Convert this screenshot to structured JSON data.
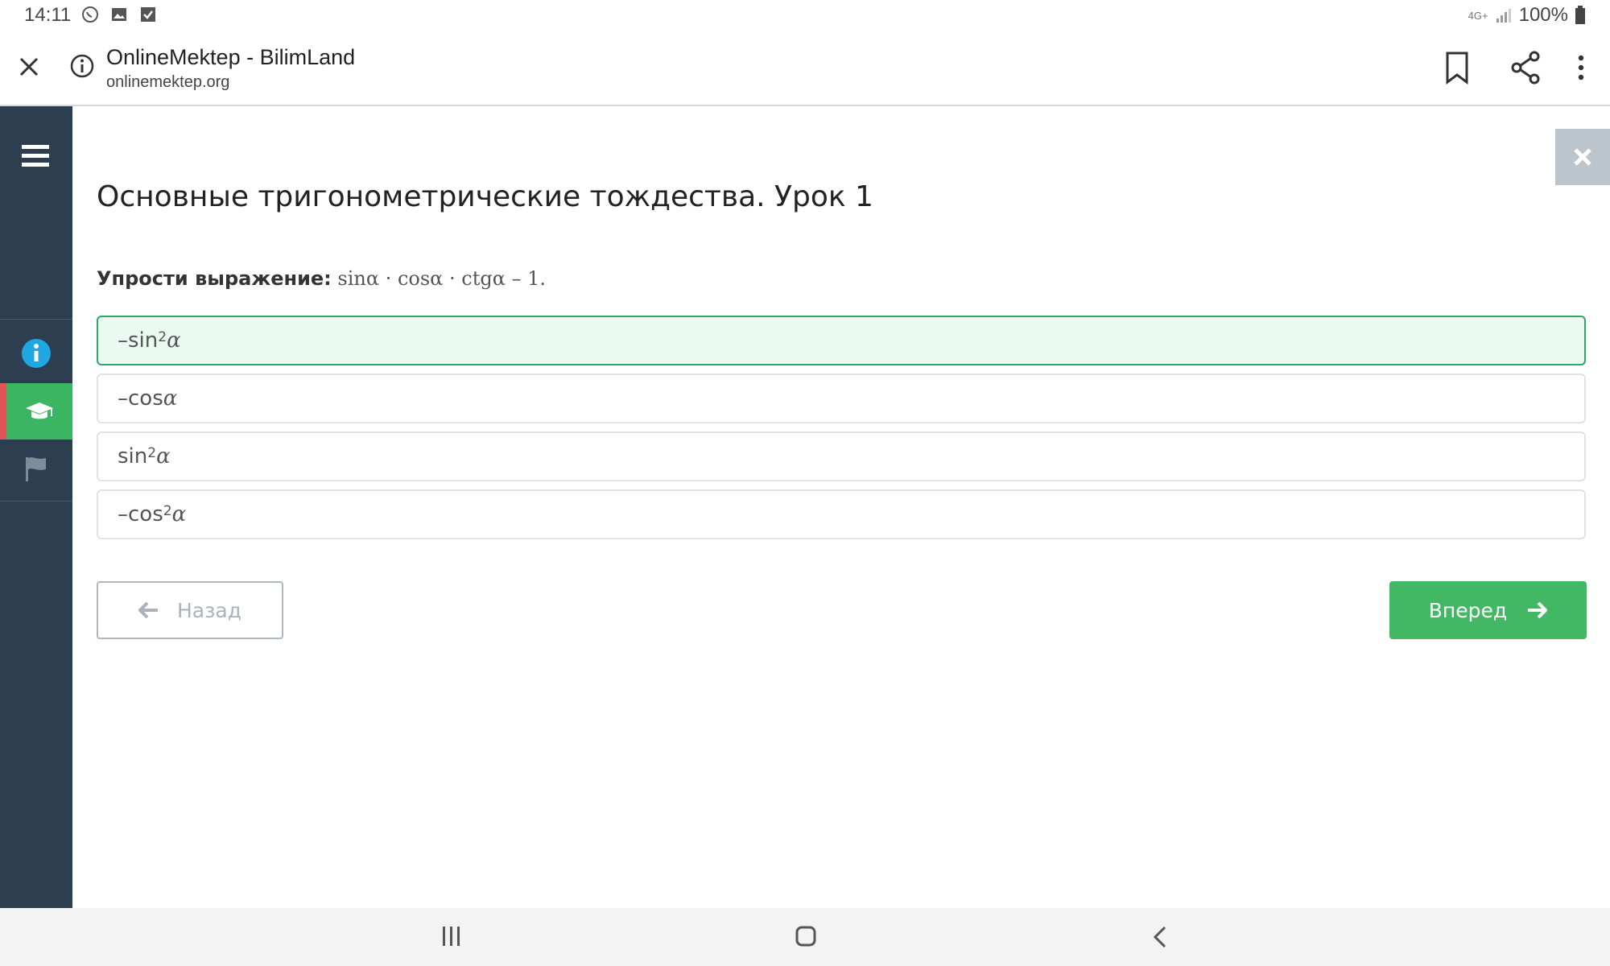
{
  "status_bar": {
    "time": "14:11",
    "network": "4G+",
    "battery": "100%",
    "icons": [
      "whatsapp-icon",
      "gallery-icon",
      "checkbox-icon",
      "signal-icon",
      "battery-icon"
    ]
  },
  "browser": {
    "page_title": "OnlineMektep - BilimLand",
    "url": "onlinemektep.org",
    "icons": [
      "close-icon",
      "info-icon",
      "bookmark-icon",
      "share-icon",
      "more-vert-icon"
    ]
  },
  "sidebar": {
    "items": [
      {
        "name": "info",
        "icon": "info-icon",
        "active": false
      },
      {
        "name": "lesson",
        "icon": "graduation-cap-icon",
        "active": true
      },
      {
        "name": "flag",
        "icon": "flag-icon",
        "active": false
      }
    ]
  },
  "lesson": {
    "title": "Основные тригонометрические тождества. Урок 1",
    "question_label": "Упрости выражение:",
    "question_expr": "sinα · cosα · ctgα – 1."
  },
  "answers": [
    {
      "prefix": "–sin",
      "sup": "2",
      "var": "α",
      "selected": true
    },
    {
      "prefix": "–cos",
      "sup": "",
      "var": "α",
      "selected": false
    },
    {
      "prefix": "sin",
      "sup": "2",
      "var": "α",
      "selected": false
    },
    {
      "prefix": "–cos",
      "sup": "2",
      "var": "α",
      "selected": false
    }
  ],
  "nav": {
    "back_label": "Назад",
    "next_label": "Вперед"
  },
  "colors": {
    "sidebar_bg": "#2c3e50",
    "accent_green": "#42b865",
    "selected_bg": "#eafaf1",
    "active_marker": "#e05555",
    "info_blue": "#1ea7e1"
  }
}
